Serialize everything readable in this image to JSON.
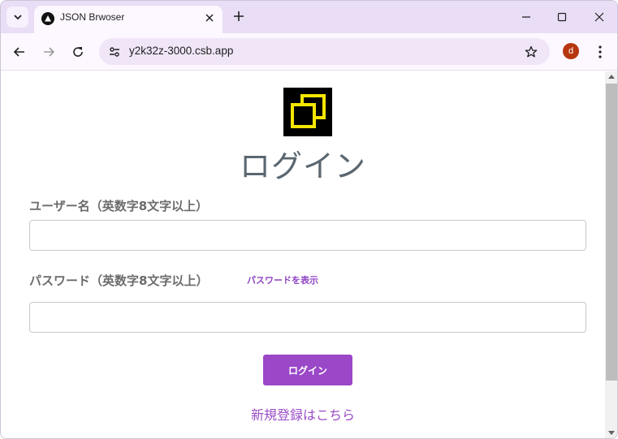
{
  "browser": {
    "tab_title": "JSON Brwoser",
    "url": "y2k32z-3000.csb.app",
    "avatar_letter": "d",
    "avatar_color": "#b5360f",
    "accent_color": "#e9def6"
  },
  "icons": {
    "tab_search": "chevron-down-icon",
    "favicon": "triangle-icon",
    "tab_close": "close-icon",
    "new_tab": "plus-icon",
    "minimize": "minimize-icon",
    "maximize": "maximize-icon",
    "close_window": "close-icon",
    "back": "back-arrow-icon",
    "forward": "forward-arrow-icon",
    "reload": "reload-icon",
    "site_info": "tune-icon",
    "bookmark": "star-icon",
    "menu": "more-vertical-icon",
    "logo": "double-square-logo"
  },
  "page": {
    "heading": "ログイン",
    "username_label": "ユーザー名（英数字8文字以上）",
    "username_value": "",
    "password_label": "パスワード（英数字8文字以上）",
    "password_value": "",
    "show_password": "パスワードを表示",
    "login_button": "ログイン",
    "register_link": "新規登録はこちら",
    "primary_color": "#9a47c8",
    "logo_color": "#f5e600"
  }
}
